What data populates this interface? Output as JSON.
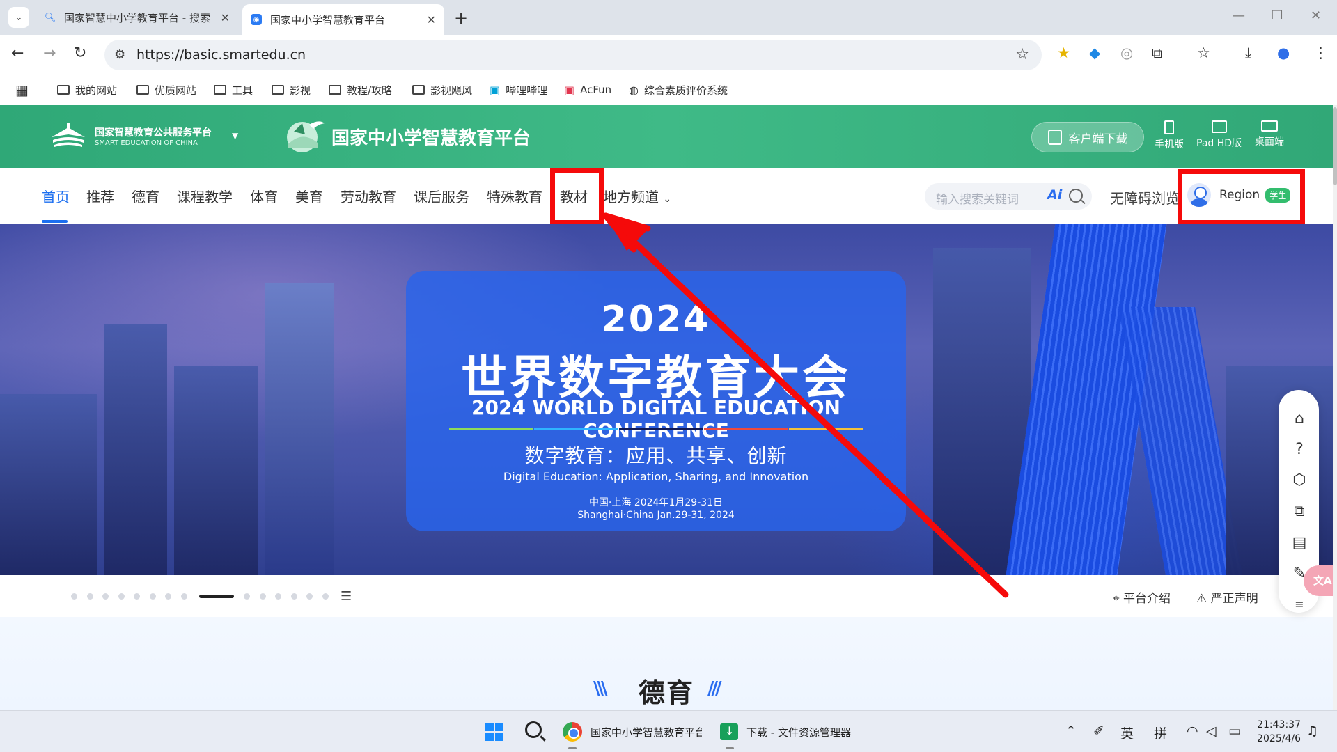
{
  "browser": {
    "tabs": [
      {
        "title": "国家智慧中小学教育平台 - 搜索",
        "favicon": "search-icon"
      },
      {
        "title": "国家中小学智慧教育平台",
        "favicon": "smartedu-icon"
      }
    ],
    "url": "https://basic.smartedu.cn",
    "bookmarks": [
      "我的网站",
      "优质网站",
      "工具",
      "影视",
      "教程/攻略",
      "影视飓风",
      "哔哩哔哩",
      "AcFun",
      "综合素质评价系统"
    ]
  },
  "header": {
    "logo_main": "国家智慧教育公共服务平台",
    "logo_sub": "SMART EDUCATION OF CHINA",
    "platform_title": "国家中小学智慧教育平台",
    "download_label": "客户端下载",
    "devices": [
      "手机版",
      "Pad HD版",
      "桌面端"
    ]
  },
  "nav": {
    "items": [
      "首页",
      "推荐",
      "德育",
      "课程教学",
      "体育",
      "美育",
      "劳动教育",
      "课后服务",
      "特殊教育",
      "教材",
      "地方频道"
    ],
    "active": "首页",
    "search_placeholder": "输入搜索关键词",
    "ai_label": "Ai",
    "accessibility": "无障碍浏览",
    "user_name": "Region",
    "user_role": "学生"
  },
  "banner": {
    "year": "2024",
    "title_cn": "世界数字教育大会",
    "title_en": "2024 WORLD DIGITAL EDUCATION CONFERENCE",
    "motto_cn": "数字教育：应用、共享、创新",
    "motto_en": "Digital Education: Application, Sharing, and Innovation",
    "date_cn": "中国·上海 2024年1月29-31日",
    "date_en": "Shanghai·China Jan.29-31, 2024"
  },
  "pager": {
    "dots_before": 8,
    "dots_after": 6,
    "intro": "平台介绍",
    "statement": "严正声明"
  },
  "section": {
    "title": "德育"
  },
  "taskbar": {
    "apps": [
      "国家中小学智慧教育平台",
      "下载 - 文件资源管理器"
    ],
    "tray_lang": "英",
    "tray_ime": "拼",
    "time": "21:43:37",
    "date": "2025/4/6"
  },
  "colors": {
    "header_green": "#3fba87",
    "nav_active": "#1c6ff0",
    "highlight": "#f50a0a",
    "role_badge": "#33bd6e"
  }
}
